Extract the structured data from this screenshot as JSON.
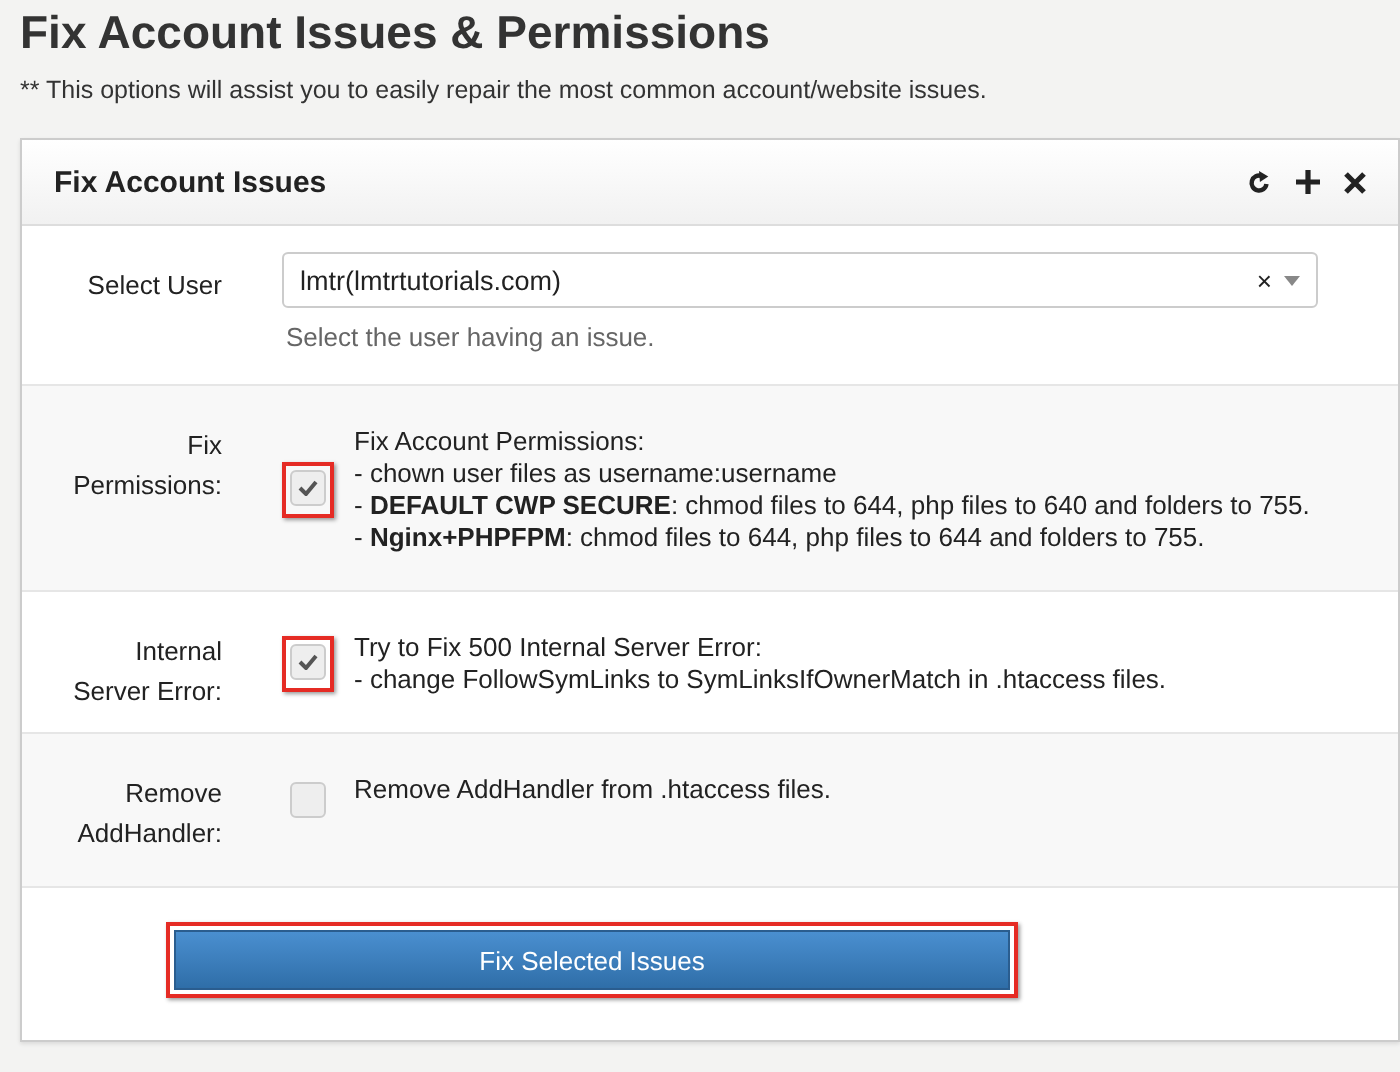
{
  "page": {
    "title": "Fix Account Issues & Permissions",
    "subtitle": "** This options will assist you to easily repair the most common account/website issues."
  },
  "panel": {
    "title": "Fix Account Issues",
    "tools": [
      {
        "kind": "refresh"
      },
      {
        "kind": "expand"
      },
      {
        "kind": "close"
      }
    ]
  },
  "user_field": {
    "label": "Select User",
    "value": "lmtr(lmtrtutorials.com)",
    "help": "Select the user having an issue.",
    "clear": "×"
  },
  "options": [
    {
      "label": "Fix Permissions:",
      "checked": true,
      "highlighted": true,
      "lines": [
        "Fix Account Permissions:",
        "- chown user files as username:username",
        "- **DEFAULT CWP SECURE**: chmod files to 644, php files to 640 and folders to 755.",
        "- **Nginx+PHPFPM**: chmod files to 644, php files to 644 and folders to 755."
      ]
    },
    {
      "label": "Internal Server Error:",
      "checked": true,
      "highlighted": true,
      "lines": [
        "Try to Fix 500 Internal Server Error:",
        "- change FollowSymLinks to SymLinksIfOwnerMatch in .htaccess files."
      ]
    },
    {
      "label": "Remove AddHandler:",
      "checked": false,
      "highlighted": false,
      "lines": [
        "Remove AddHandler from .htaccess files."
      ]
    }
  ],
  "submit": {
    "label": "Fix Selected Issues",
    "highlighted": true
  }
}
